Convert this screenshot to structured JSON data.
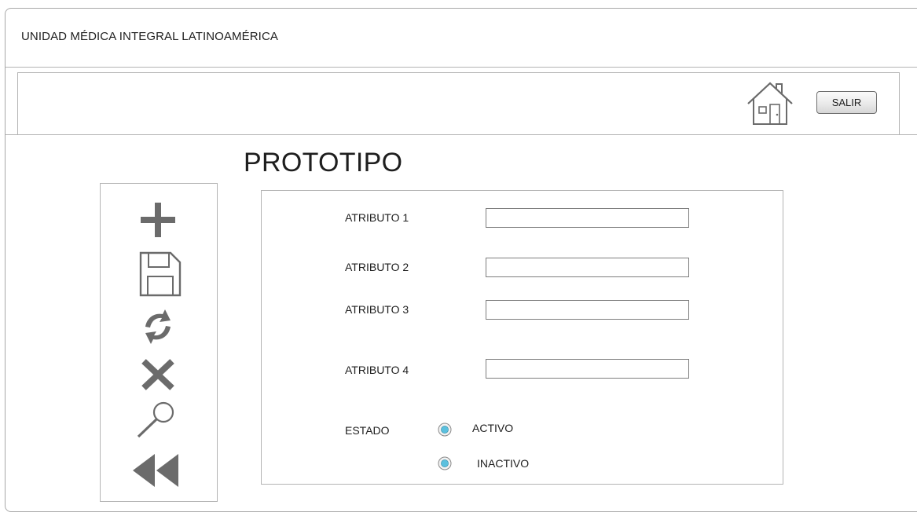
{
  "app": {
    "title": "UNIDAD MÉDICA INTEGRAL LATINOAMÉRICA"
  },
  "toolbar": {
    "home_icon": "home-icon",
    "exit_label": "SALIR"
  },
  "page": {
    "title": "PROTOTIPO"
  },
  "sidebar": {
    "actions": [
      {
        "name": "add",
        "icon": "plus-icon"
      },
      {
        "name": "save",
        "icon": "floppy-disk-icon"
      },
      {
        "name": "refresh",
        "icon": "refresh-icon"
      },
      {
        "name": "delete",
        "icon": "close-icon"
      },
      {
        "name": "search",
        "icon": "search-icon"
      },
      {
        "name": "back",
        "icon": "rewind-icon"
      }
    ]
  },
  "form": {
    "fields": [
      {
        "label": "ATRIBUTO 1",
        "value": ""
      },
      {
        "label": "ATRIBUTO 2",
        "value": ""
      },
      {
        "label": "ATRIBUTO 3",
        "value": ""
      },
      {
        "label": "ATRIBUTO 4",
        "value": ""
      }
    ],
    "status": {
      "label": "ESTADO",
      "options": [
        {
          "label": "ACTIVO"
        },
        {
          "label": "INACTIVO"
        }
      ]
    }
  },
  "colors": {
    "icon_gray": "#6b6b6b",
    "border_gray": "#b4b4b4",
    "radio_fill": "#5bc0de"
  }
}
